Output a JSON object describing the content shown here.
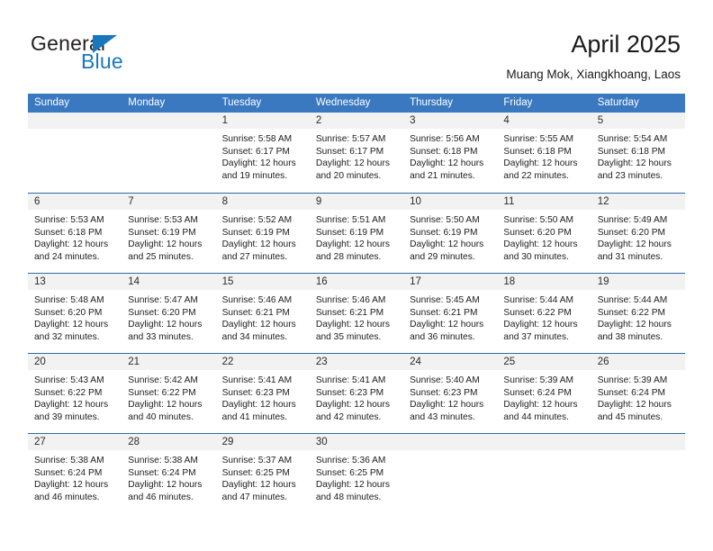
{
  "brand": {
    "name_top": "General",
    "name_bottom": "Blue",
    "triangle_icon": "triangle-icon",
    "color_dark": "#231f20",
    "color_blue": "#1878be"
  },
  "header": {
    "title": "April 2025",
    "subtitle": "Muang Mok, Xiangkhoang, Laos"
  },
  "theme": {
    "header_bar": "#3a78c0",
    "row_divider": "#2f6aad",
    "day_strip": "#f2f2f2",
    "page_background": "#ffffff"
  },
  "calendar": {
    "weekdays": [
      "Sunday",
      "Monday",
      "Tuesday",
      "Wednesday",
      "Thursday",
      "Friday",
      "Saturday"
    ],
    "weeks": [
      [
        {
          "day": "",
          "lines": []
        },
        {
          "day": "",
          "lines": []
        },
        {
          "day": "1",
          "lines": [
            "Sunrise: 5:58 AM",
            "Sunset: 6:17 PM",
            "Daylight: 12 hours",
            "and 19 minutes."
          ]
        },
        {
          "day": "2",
          "lines": [
            "Sunrise: 5:57 AM",
            "Sunset: 6:17 PM",
            "Daylight: 12 hours",
            "and 20 minutes."
          ]
        },
        {
          "day": "3",
          "lines": [
            "Sunrise: 5:56 AM",
            "Sunset: 6:18 PM",
            "Daylight: 12 hours",
            "and 21 minutes."
          ]
        },
        {
          "day": "4",
          "lines": [
            "Sunrise: 5:55 AM",
            "Sunset: 6:18 PM",
            "Daylight: 12 hours",
            "and 22 minutes."
          ]
        },
        {
          "day": "5",
          "lines": [
            "Sunrise: 5:54 AM",
            "Sunset: 6:18 PM",
            "Daylight: 12 hours",
            "and 23 minutes."
          ]
        }
      ],
      [
        {
          "day": "6",
          "lines": [
            "Sunrise: 5:53 AM",
            "Sunset: 6:18 PM",
            "Daylight: 12 hours",
            "and 24 minutes."
          ]
        },
        {
          "day": "7",
          "lines": [
            "Sunrise: 5:53 AM",
            "Sunset: 6:19 PM",
            "Daylight: 12 hours",
            "and 25 minutes."
          ]
        },
        {
          "day": "8",
          "lines": [
            "Sunrise: 5:52 AM",
            "Sunset: 6:19 PM",
            "Daylight: 12 hours",
            "and 27 minutes."
          ]
        },
        {
          "day": "9",
          "lines": [
            "Sunrise: 5:51 AM",
            "Sunset: 6:19 PM",
            "Daylight: 12 hours",
            "and 28 minutes."
          ]
        },
        {
          "day": "10",
          "lines": [
            "Sunrise: 5:50 AM",
            "Sunset: 6:19 PM",
            "Daylight: 12 hours",
            "and 29 minutes."
          ]
        },
        {
          "day": "11",
          "lines": [
            "Sunrise: 5:50 AM",
            "Sunset: 6:20 PM",
            "Daylight: 12 hours",
            "and 30 minutes."
          ]
        },
        {
          "day": "12",
          "lines": [
            "Sunrise: 5:49 AM",
            "Sunset: 6:20 PM",
            "Daylight: 12 hours",
            "and 31 minutes."
          ]
        }
      ],
      [
        {
          "day": "13",
          "lines": [
            "Sunrise: 5:48 AM",
            "Sunset: 6:20 PM",
            "Daylight: 12 hours",
            "and 32 minutes."
          ]
        },
        {
          "day": "14",
          "lines": [
            "Sunrise: 5:47 AM",
            "Sunset: 6:20 PM",
            "Daylight: 12 hours",
            "and 33 minutes."
          ]
        },
        {
          "day": "15",
          "lines": [
            "Sunrise: 5:46 AM",
            "Sunset: 6:21 PM",
            "Daylight: 12 hours",
            "and 34 minutes."
          ]
        },
        {
          "day": "16",
          "lines": [
            "Sunrise: 5:46 AM",
            "Sunset: 6:21 PM",
            "Daylight: 12 hours",
            "and 35 minutes."
          ]
        },
        {
          "day": "17",
          "lines": [
            "Sunrise: 5:45 AM",
            "Sunset: 6:21 PM",
            "Daylight: 12 hours",
            "and 36 minutes."
          ]
        },
        {
          "day": "18",
          "lines": [
            "Sunrise: 5:44 AM",
            "Sunset: 6:22 PM",
            "Daylight: 12 hours",
            "and 37 minutes."
          ]
        },
        {
          "day": "19",
          "lines": [
            "Sunrise: 5:44 AM",
            "Sunset: 6:22 PM",
            "Daylight: 12 hours",
            "and 38 minutes."
          ]
        }
      ],
      [
        {
          "day": "20",
          "lines": [
            "Sunrise: 5:43 AM",
            "Sunset: 6:22 PM",
            "Daylight: 12 hours",
            "and 39 minutes."
          ]
        },
        {
          "day": "21",
          "lines": [
            "Sunrise: 5:42 AM",
            "Sunset: 6:22 PM",
            "Daylight: 12 hours",
            "and 40 minutes."
          ]
        },
        {
          "day": "22",
          "lines": [
            "Sunrise: 5:41 AM",
            "Sunset: 6:23 PM",
            "Daylight: 12 hours",
            "and 41 minutes."
          ]
        },
        {
          "day": "23",
          "lines": [
            "Sunrise: 5:41 AM",
            "Sunset: 6:23 PM",
            "Daylight: 12 hours",
            "and 42 minutes."
          ]
        },
        {
          "day": "24",
          "lines": [
            "Sunrise: 5:40 AM",
            "Sunset: 6:23 PM",
            "Daylight: 12 hours",
            "and 43 minutes."
          ]
        },
        {
          "day": "25",
          "lines": [
            "Sunrise: 5:39 AM",
            "Sunset: 6:24 PM",
            "Daylight: 12 hours",
            "and 44 minutes."
          ]
        },
        {
          "day": "26",
          "lines": [
            "Sunrise: 5:39 AM",
            "Sunset: 6:24 PM",
            "Daylight: 12 hours",
            "and 45 minutes."
          ]
        }
      ],
      [
        {
          "day": "27",
          "lines": [
            "Sunrise: 5:38 AM",
            "Sunset: 6:24 PM",
            "Daylight: 12 hours",
            "and 46 minutes."
          ]
        },
        {
          "day": "28",
          "lines": [
            "Sunrise: 5:38 AM",
            "Sunset: 6:24 PM",
            "Daylight: 12 hours",
            "and 46 minutes."
          ]
        },
        {
          "day": "29",
          "lines": [
            "Sunrise: 5:37 AM",
            "Sunset: 6:25 PM",
            "Daylight: 12 hours",
            "and 47 minutes."
          ]
        },
        {
          "day": "30",
          "lines": [
            "Sunrise: 5:36 AM",
            "Sunset: 6:25 PM",
            "Daylight: 12 hours",
            "and 48 minutes."
          ]
        },
        {
          "day": "",
          "lines": []
        },
        {
          "day": "",
          "lines": []
        },
        {
          "day": "",
          "lines": []
        }
      ]
    ]
  }
}
